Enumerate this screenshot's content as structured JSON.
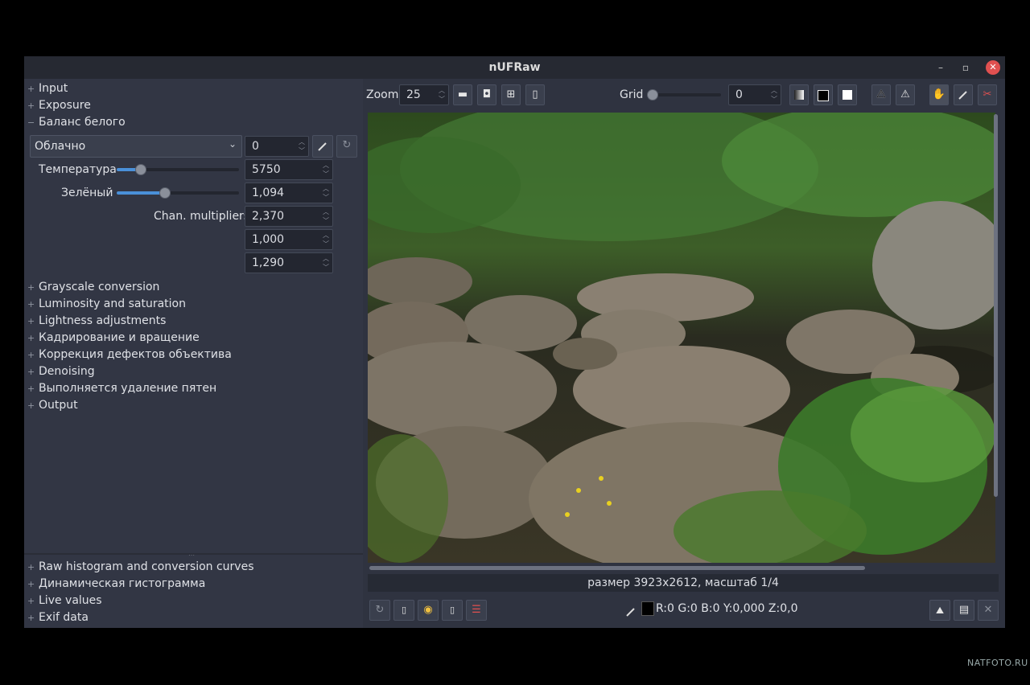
{
  "window": {
    "title": "nUFRaw",
    "minimize": "–",
    "maximize": "▫",
    "close": "✕"
  },
  "left_panel": {
    "sections_top": [
      {
        "label": "Input",
        "expanded": false
      },
      {
        "label": "Exposure",
        "expanded": false
      },
      {
        "label": "Баланс белого",
        "expanded": true
      }
    ],
    "white_balance": {
      "preset": "Облачно",
      "fine_tune": "0",
      "temperature_label": "Температура",
      "temperature": "5750",
      "temperature_level": 0.19,
      "green_label": "Зелёный",
      "green": "1,094",
      "green_level": 0.39,
      "chan_label": "Chan. multipliers",
      "chan_multipliers": [
        "2,370",
        "1,000",
        "1,290"
      ]
    },
    "sections_mid": [
      {
        "label": "Grayscale conversion"
      },
      {
        "label": "Luminosity and saturation"
      },
      {
        "label": "Lightness adjustments"
      },
      {
        "label": "Кадрирование и вращение"
      },
      {
        "label": "Коррекция дефектов объектива"
      },
      {
        "label": "Denoising"
      },
      {
        "label": "Выполняется удаление пятен"
      },
      {
        "label": "Output"
      }
    ],
    "sections_bottom": [
      {
        "label": "Raw histogram and conversion curves"
      },
      {
        "label": "Динамическая гистограмма"
      },
      {
        "label": "Live values"
      },
      {
        "label": "Exif data"
      }
    ],
    "expander_plus": "+",
    "expander_minus": "−"
  },
  "toolbar": {
    "zoom_label": "Zoom",
    "zoom_value": "25",
    "grid_label": "Grid",
    "grid_value": "0",
    "grid_level": 0.0
  },
  "status": {
    "text": "размер 3923x2612, масштаб 1/4"
  },
  "bottom_bar": {
    "pixel_values": "R:0 G:0 B:0 Y:0,000 Z:0,0"
  },
  "watermark": "NATFOTO.RU",
  "colors": {
    "accent": "#4a90d9",
    "close": "#e05050",
    "panel": "#323644"
  }
}
